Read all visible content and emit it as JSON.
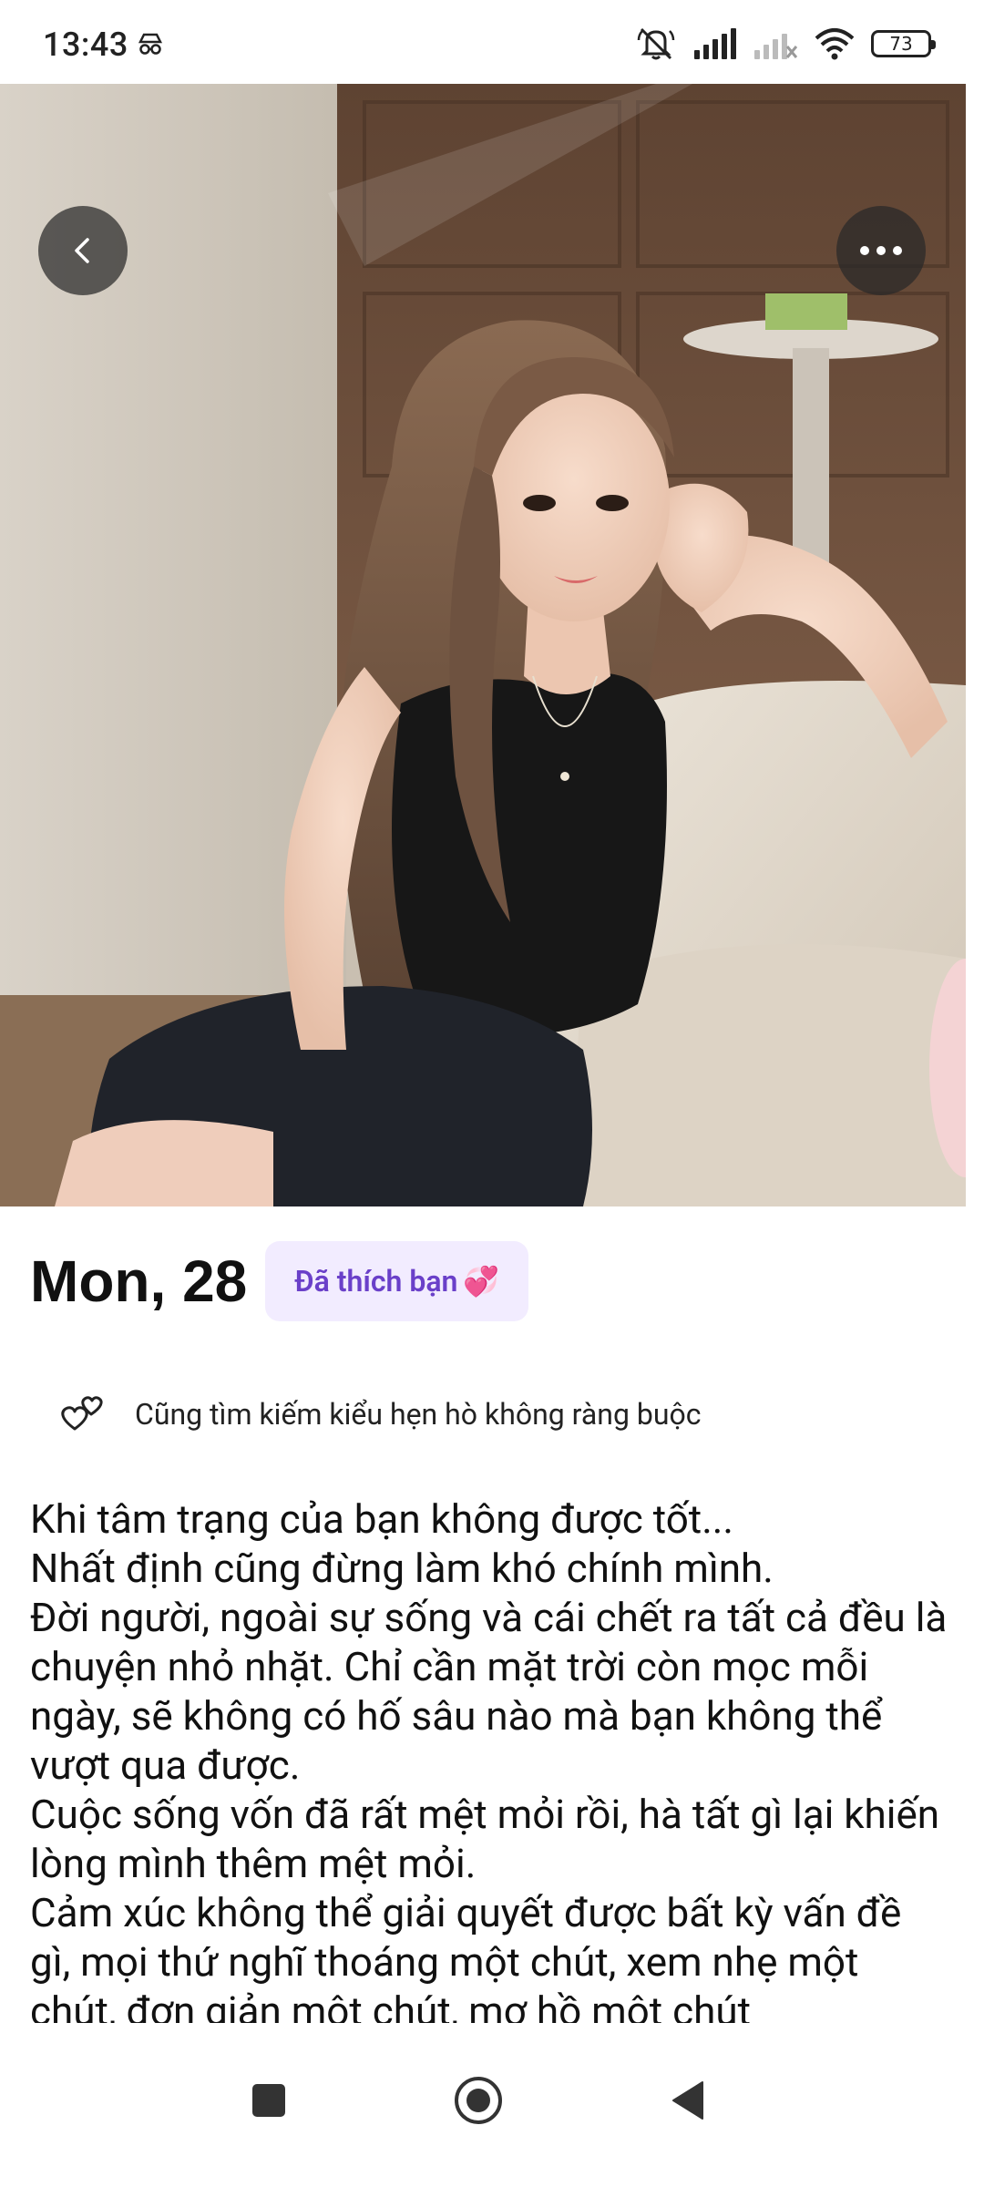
{
  "status_bar": {
    "time": "13:43",
    "battery": "73",
    "icons": [
      "incognito-icon",
      "muted-bell-icon",
      "signal-icon",
      "signal-weak-icon",
      "wifi-icon",
      "battery-icon"
    ]
  },
  "photo": {
    "back_icon": "chevron-left-icon",
    "more_icon": "more-horizontal-icon"
  },
  "profile": {
    "name": "Mon, 28",
    "liked_chip": "Đã thích bạn",
    "liked_emoji": "💞",
    "intent_icon": "hearts-icon",
    "intent_text": "Cũng tìm kiếm kiểu hẹn hò không ràng buộc",
    "bio": "Khi tâm trạng của bạn không được tốt...\nNhất định cũng đừng làm khó chính mình.\nĐời người, ngoài sự sống và cái chết ra tất cả đều là chuyện nhỏ nhặt. Chỉ cần mặt trời còn mọc mỗi ngày, sẽ không có hố sâu nào mà bạn không thể vượt qua được.\nCuộc sống vốn đã rất mệt mỏi rồi, hà tất gì lại khiến lòng mình thêm mệt mỏi.\nCảm xúc không thể giải quyết được bất kỳ vấn đề gì, mọi thứ nghĩ thoáng một chút, xem nhẹ một chút, đơn giản một chút, mơ hồ một chút"
  },
  "nav_bar": {
    "recents_icon": "square-icon",
    "home_icon": "circle-icon",
    "back_icon": "triangle-back-icon"
  },
  "colors": {
    "chip_bg": "#f2ecff",
    "chip_text": "#6a40c9",
    "overlay_button": "#282828"
  }
}
